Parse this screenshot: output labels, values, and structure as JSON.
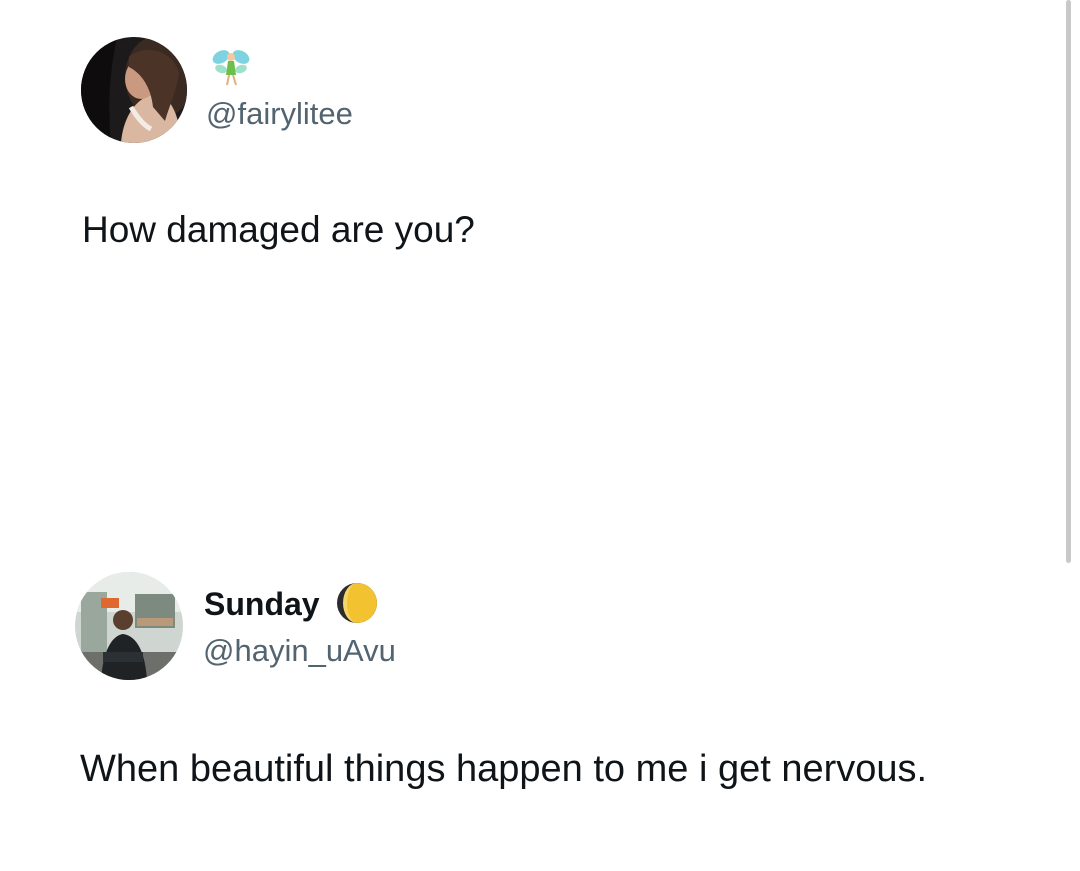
{
  "tweet": {
    "handle": "@fairylitee",
    "name_emoji": "fairy-emoji",
    "text": "How damaged are you?"
  },
  "reply": {
    "display_name": "Sunday",
    "name_emoji": "moon-phase-emoji",
    "handle": "@hayin_uAvu",
    "text": "When beautiful things happen to me i get nervous."
  },
  "colors": {
    "handle_gray": "#536471",
    "text": "#0f1419",
    "moon_yellow": "#f2c230"
  }
}
